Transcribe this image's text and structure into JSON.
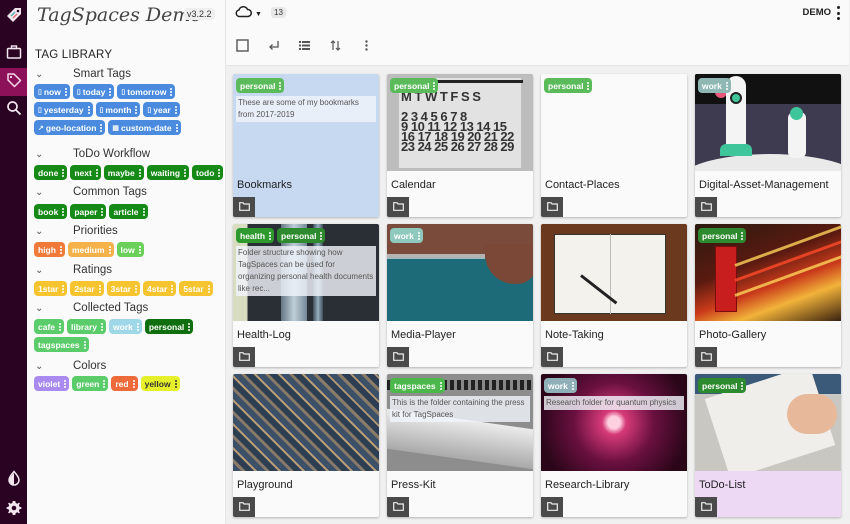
{
  "app": {
    "title": "TagSpaces Demo",
    "version": "v3.2.2"
  },
  "vnav": {
    "items": [
      {
        "name": "tag-spaces-logo",
        "icon": "tag-logo-icon"
      },
      {
        "name": "locations",
        "icon": "briefcase-icon"
      },
      {
        "name": "tag-library",
        "icon": "tag-icon",
        "active": true
      },
      {
        "name": "search",
        "icon": "search-icon"
      },
      {
        "name": "theme-toggle",
        "icon": "contrast-drop-icon"
      },
      {
        "name": "settings",
        "icon": "gear-icon"
      }
    ],
    "colors": {
      "background": "#2b0322",
      "active": "#8c1159"
    }
  },
  "tag_library": {
    "title": "TAG LIBRARY",
    "groups": [
      {
        "name": "Smart Tags",
        "tags": [
          {
            "label": "now",
            "color": "#4a8be0",
            "icon": "calendar-icon"
          },
          {
            "label": "today",
            "color": "#4a8be0",
            "icon": "calendar-icon"
          },
          {
            "label": "tomorrow",
            "color": "#4a8be0",
            "icon": "calendar-icon"
          },
          {
            "label": "yesterday",
            "color": "#4a8be0",
            "icon": "calendar-icon"
          },
          {
            "label": "month",
            "color": "#4a8be0",
            "icon": "calendar-icon"
          },
          {
            "label": "year",
            "color": "#4a8be0",
            "icon": "calendar-icon"
          },
          {
            "label": "geo-location",
            "color": "#4a8be0",
            "icon": "pin-icon"
          },
          {
            "label": "custom-date",
            "color": "#4a8be0",
            "icon": "date-grid-icon"
          }
        ]
      },
      {
        "name": "ToDo Workflow",
        "tags": [
          {
            "label": "done",
            "color": "#168a16"
          },
          {
            "label": "next",
            "color": "#168a16"
          },
          {
            "label": "maybe",
            "color": "#168a16"
          },
          {
            "label": "waiting",
            "color": "#168a16"
          },
          {
            "label": "todo",
            "color": "#168a16"
          }
        ]
      },
      {
        "name": "Common Tags",
        "tags": [
          {
            "label": "book",
            "color": "#168a16"
          },
          {
            "label": "paper",
            "color": "#168a16"
          },
          {
            "label": "article",
            "color": "#168a16"
          }
        ]
      },
      {
        "name": "Priorities",
        "tags": [
          {
            "label": "high",
            "color": "#ef7a3a"
          },
          {
            "label": "medium",
            "color": "#f5b14a"
          },
          {
            "label": "low",
            "color": "#6ad05a"
          }
        ]
      },
      {
        "name": "Ratings",
        "tags": [
          {
            "label": "1star",
            "color": "#f6c42e"
          },
          {
            "label": "2star",
            "color": "#f6c42e"
          },
          {
            "label": "3star",
            "color": "#f6c42e"
          },
          {
            "label": "4star",
            "color": "#f6c42e"
          },
          {
            "label": "5star",
            "color": "#f6c42e"
          }
        ]
      },
      {
        "name": "Collected Tags",
        "tags": [
          {
            "label": "cafe",
            "color": "#5bcc6a"
          },
          {
            "label": "library",
            "color": "#5bcc6a"
          },
          {
            "label": "work",
            "color": "#9ed8e8"
          },
          {
            "label": "personal",
            "color": "#0f6f0f"
          },
          {
            "label": "tagspaces",
            "color": "#5bcc6a"
          }
        ]
      },
      {
        "name": "Colors",
        "tags": [
          {
            "label": "violet",
            "color": "#a98bf0"
          },
          {
            "label": "green",
            "color": "#5bcc6a"
          },
          {
            "label": "red",
            "color": "#ef6a3a"
          },
          {
            "label": "yellow",
            "color": "#e6f02a",
            "text_color": "#333333"
          }
        ]
      }
    ]
  },
  "topbar": {
    "location_icon": "cloud-icon",
    "count": "13",
    "location_name": "DEMO"
  },
  "toolbar": {
    "buttons": [
      {
        "name": "select-all",
        "icon": "checkbox-icon"
      },
      {
        "name": "go-back",
        "icon": "return-arrow-icon"
      },
      {
        "name": "toggle-view",
        "icon": "list-view-icon"
      },
      {
        "name": "sort",
        "icon": "sort-icon"
      },
      {
        "name": "more",
        "icon": "more-vertical-icon"
      }
    ]
  },
  "grid": {
    "folders": [
      {
        "name": "Bookmarks",
        "thumb": "none",
        "selected": true,
        "tags": [
          {
            "label": "personal",
            "color": "#5bbb5b"
          }
        ],
        "description": "These are some of my bookmarks from 2017-2019"
      },
      {
        "name": "Calendar",
        "thumb": "calendar",
        "tags": [
          {
            "label": "personal",
            "color": "#5bbb5b"
          }
        ]
      },
      {
        "name": "Contact-Places",
        "thumb": "none",
        "tags": [
          {
            "label": "personal",
            "color": "#5bbb5b"
          }
        ]
      },
      {
        "name": "Digital-Asset-Management",
        "thumb": "dam",
        "tags": [
          {
            "label": "work",
            "color": "#8fb8b4"
          }
        ]
      },
      {
        "name": "Health-Log",
        "thumb": "health",
        "tags": [
          {
            "label": "health",
            "color": "#2e9a2e"
          },
          {
            "label": "personal",
            "color": "#2e8a2e"
          }
        ],
        "description": "Folder structure showing how TagSpaces can be used for organizing personal health documents like rec..."
      },
      {
        "name": "Media-Player",
        "thumb": "media",
        "tags": [
          {
            "label": "work",
            "color": "#8fc8bc"
          }
        ]
      },
      {
        "name": "Note-Taking",
        "thumb": "note",
        "tags": []
      },
      {
        "name": "Photo-Gallery",
        "thumb": "photo",
        "tags": [
          {
            "label": "personal",
            "color": "#2e8a2e"
          }
        ]
      },
      {
        "name": "Playground",
        "thumb": "play",
        "tags": []
      },
      {
        "name": "Press-Kit",
        "thumb": "press",
        "tags": [
          {
            "label": "tagspaces",
            "color": "#4cb84c"
          }
        ],
        "description": "This is the folder containing the press kit for TagSpaces"
      },
      {
        "name": "Research-Library",
        "thumb": "research",
        "tags": [
          {
            "label": "work",
            "color": "#8fb0b8"
          }
        ],
        "description": "Research folder for quantum physics"
      },
      {
        "name": "ToDo-List",
        "thumb": "todo",
        "todo": true,
        "tags": [
          {
            "label": "personal",
            "color": "#2e8a2e"
          }
        ]
      }
    ]
  }
}
